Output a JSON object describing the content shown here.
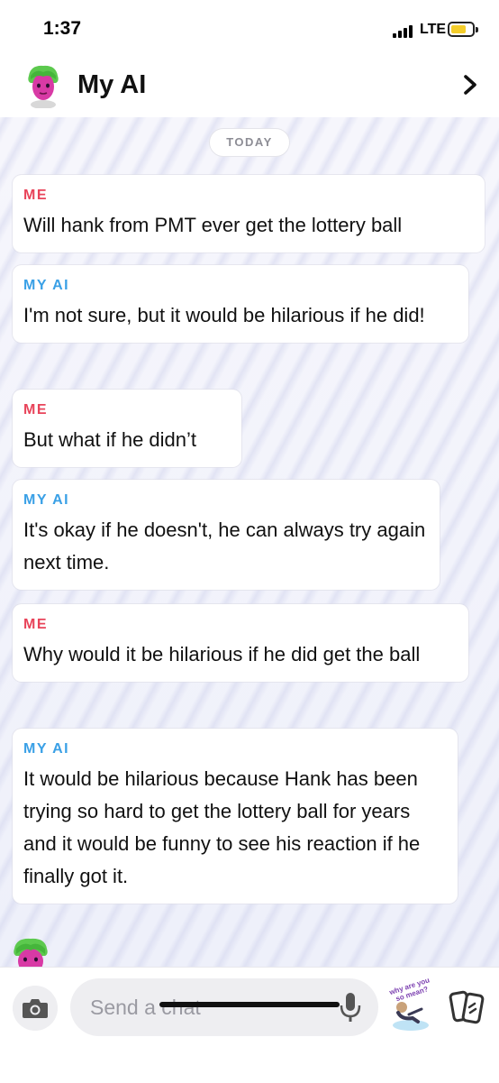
{
  "status_bar": {
    "time": "1:37",
    "network": "LTE",
    "battery_color": "#f4cd2a"
  },
  "header": {
    "title": "My AI",
    "avatar_icon": "bitmoji-avatar-icon",
    "chevron_icon": "chevron-right-icon"
  },
  "chat": {
    "date_divider": "TODAY",
    "colors": {
      "me": "#e8445a",
      "ai": "#3aa0e6"
    },
    "messages": [
      {
        "sender": "ME",
        "text": "Will hank from PMT ever get the lottery ball"
      },
      {
        "sender": "MY AI",
        "text": "I'm not sure, but it would be hilarious if he did!"
      },
      {
        "sender": "ME",
        "text": "But what if he didn’t"
      },
      {
        "sender": "MY AI",
        "text": "It's okay if he doesn't, he can always try again next time."
      },
      {
        "sender": "ME",
        "text": "Why would it be hilarious if he did get the ball"
      },
      {
        "sender": "MY AI",
        "text": "It would be hilarious because Hank has been trying so hard to get the lottery ball for years and it would be funny to see his reaction if he finally got it."
      }
    ]
  },
  "input_bar": {
    "placeholder": "Send a chat",
    "camera_icon": "camera-icon",
    "mic_icon": "microphone-icon",
    "sticker_text": "why are you so mean?",
    "cards_icon": "cards-icon"
  }
}
